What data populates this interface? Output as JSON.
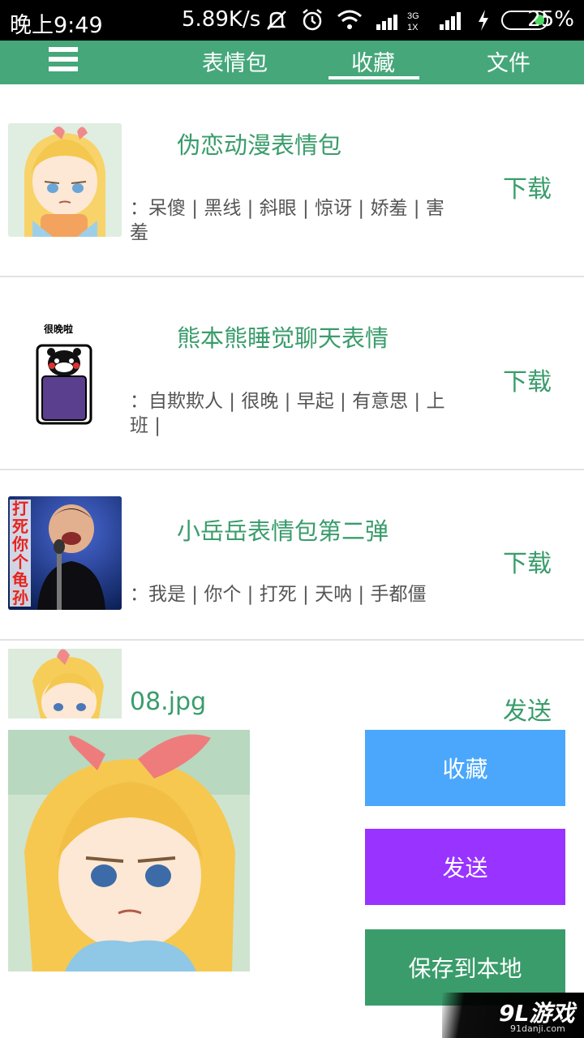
{
  "status_bar": {
    "time": "晚上9:49",
    "network_speed": "5.89K/s",
    "icons": [
      "mute-icon",
      "alarm-icon",
      "wifi-icon",
      "signal-3g-icon",
      "signal-icon",
      "charging-icon",
      "battery-icon"
    ],
    "battery_percent": "25%"
  },
  "nav": {
    "menu_icon": "hamburger-menu-icon",
    "tabs": [
      {
        "label": "表情包"
      },
      {
        "label": "收藏"
      },
      {
        "label": "文件"
      }
    ],
    "active_tab": "收藏",
    "accent_color": "#45a77a"
  },
  "favorites": [
    {
      "title": "伪恋动漫表情包",
      "tags": "：呆傻 | 黑线 | 斜眼 | 惊讶 | 娇羞 | 害羞",
      "action": "下载",
      "thumb_icon": "anime-girl-thumbnail"
    },
    {
      "title": "熊本熊睡觉聊天表情",
      "tags": "：自欺欺人 | 很晚 | 早起 | 有意思 | 上班 |",
      "action": "下载",
      "thumb_icon": "kumamon-sleeping-thumbnail",
      "thumb_caption": "很晚啦"
    },
    {
      "title": "小岳岳表情包第二弹",
      "tags": "：我是 | 你个 | 打死 | 天呐 | 手都僵",
      "action": "下载",
      "thumb_icon": "comedian-thumbnail",
      "thumb_caption": "打死你个龟孙"
    }
  ],
  "preview": {
    "filename": "08.jpg",
    "send_label": "发送",
    "image_icon": "anime-girl-preview"
  },
  "actions": [
    {
      "label": "收藏",
      "color": "#4aa7fc"
    },
    {
      "label": "发送",
      "color": "#9933ff"
    },
    {
      "label": "保存到本地",
      "color": "#3a9c6b"
    }
  ],
  "watermark": {
    "logo": "9L游戏",
    "url": "91danji.com"
  }
}
